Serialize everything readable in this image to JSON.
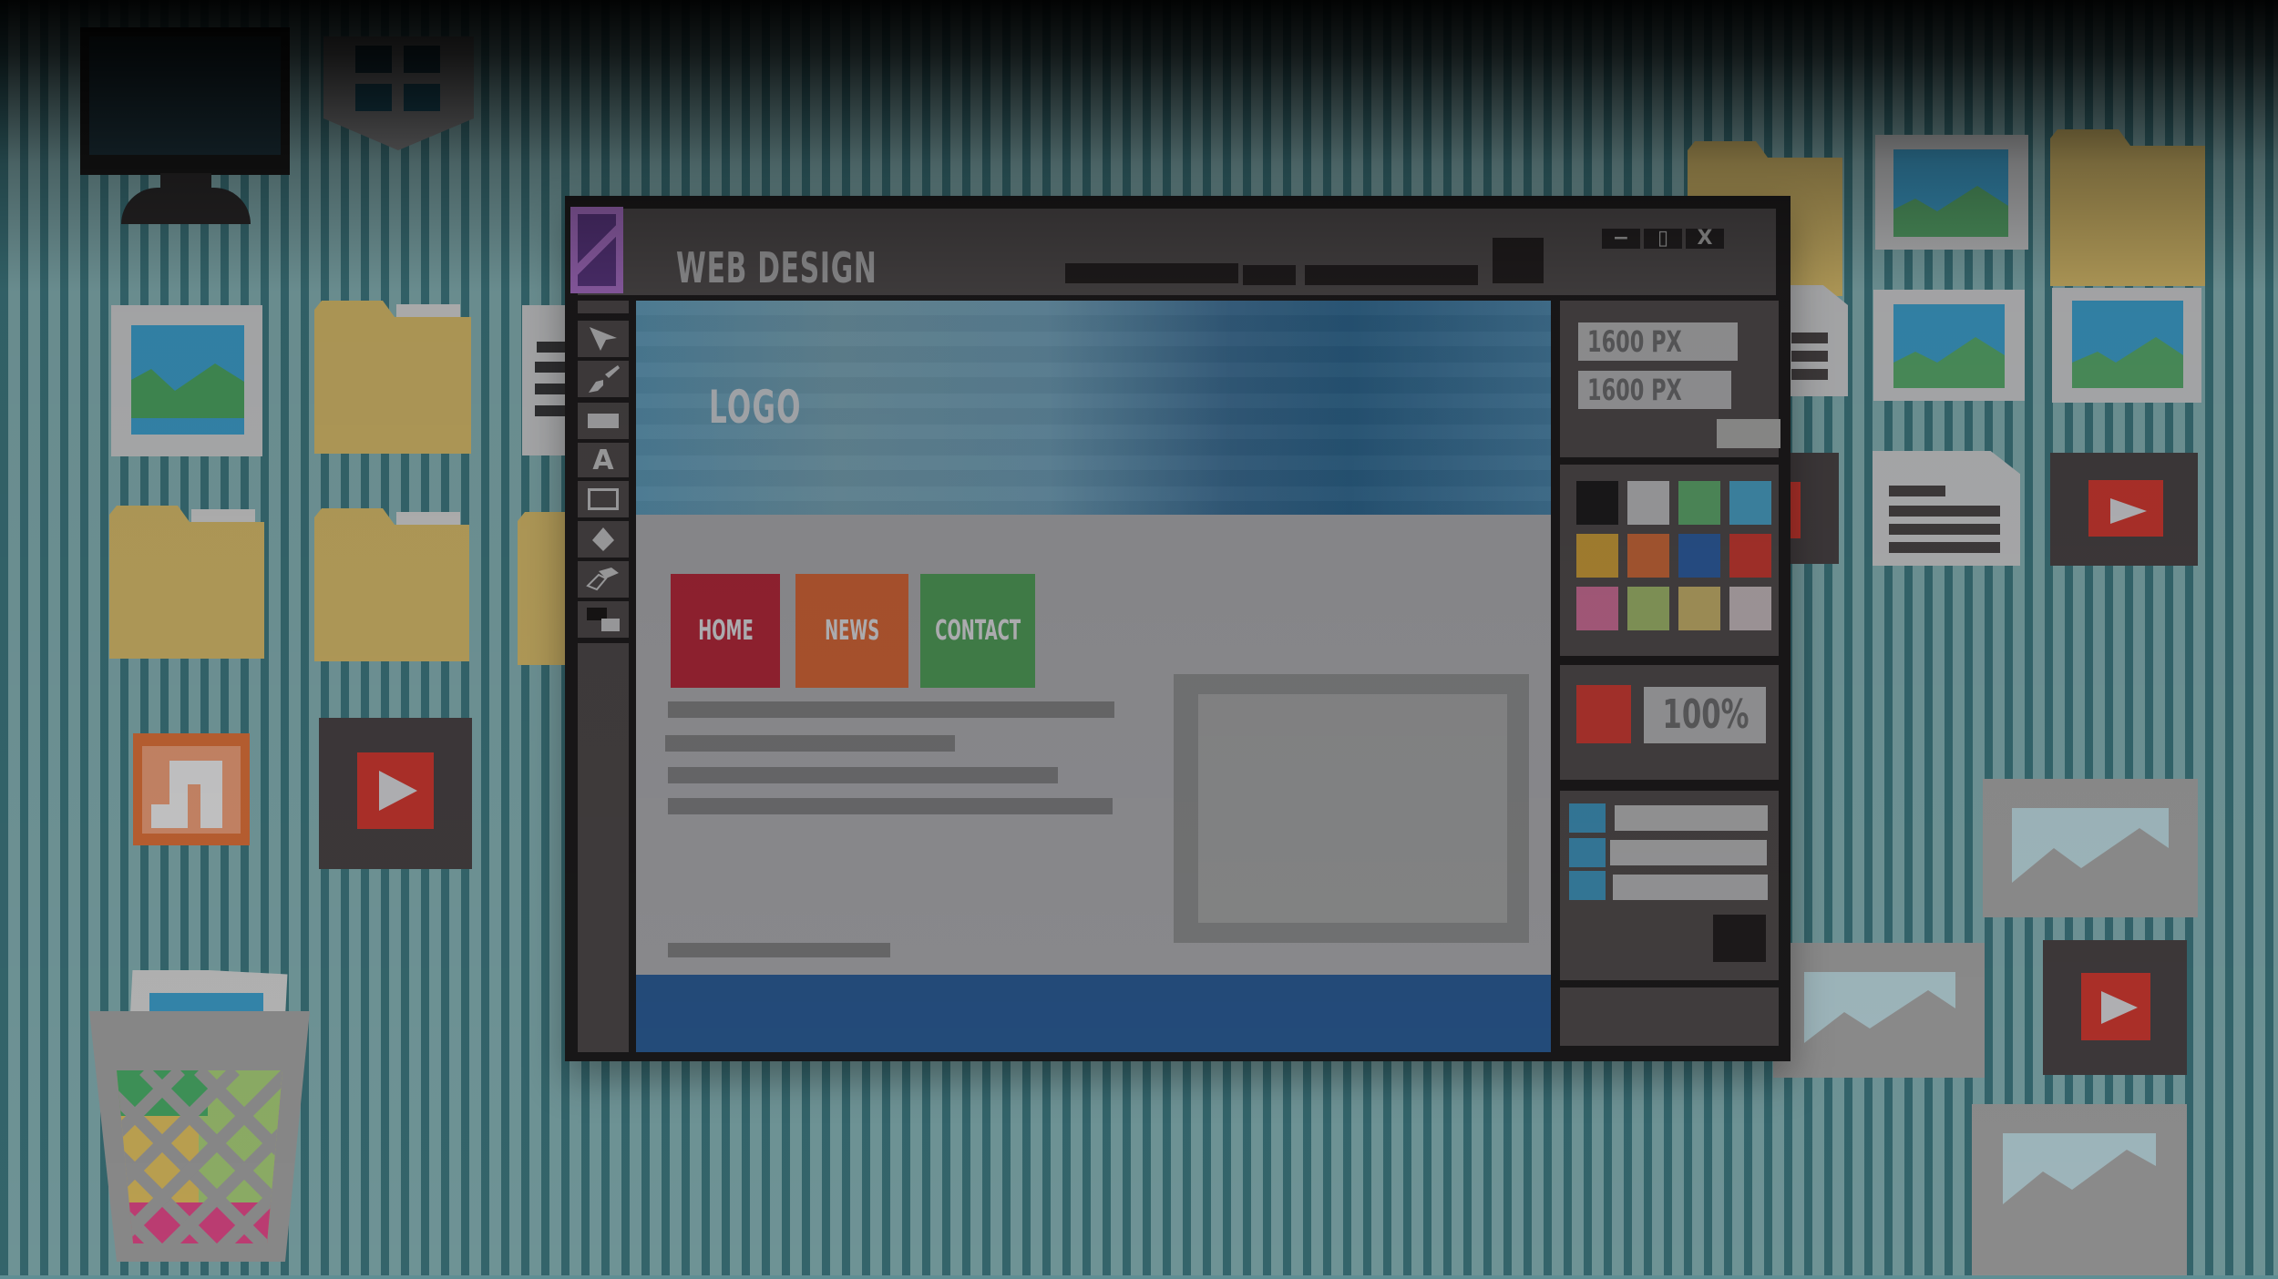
{
  "window": {
    "title": "WEB DESIGN",
    "controls": {
      "minimize": "−",
      "maximize": "▯",
      "close": "X"
    }
  },
  "toolbar": {
    "tools": [
      {
        "name": "select-tool",
        "icon": "arrow-pointer-icon"
      },
      {
        "name": "brush-tool",
        "icon": "paintbrush-icon"
      },
      {
        "name": "rectangle-fill-tool",
        "icon": "filled-rectangle-icon"
      },
      {
        "name": "text-tool",
        "icon": "letter-a-icon",
        "glyph": "A"
      },
      {
        "name": "rectangle-outline-tool",
        "icon": "outline-rectangle-icon"
      },
      {
        "name": "shape-tool",
        "icon": "diamond-icon"
      },
      {
        "name": "eraser-tool",
        "icon": "eraser-icon"
      },
      {
        "name": "color-swap-tool",
        "icon": "fg-bg-color-icon"
      }
    ]
  },
  "canvas": {
    "logo": "LOGO",
    "nav": [
      {
        "label": "HOME",
        "color": "#b0283a"
      },
      {
        "label": "NEWS",
        "color": "#cf6437"
      },
      {
        "label": "CONTACT",
        "color": "#4f9a58"
      }
    ],
    "colors": {
      "hero_start": "#5d99b8",
      "hero_end": "#2f6790",
      "footer": "#2b5c95",
      "body": "#a8a8ac"
    }
  },
  "properties": {
    "width": "1600 PX",
    "height": "1600 PX",
    "zoom": "100%",
    "current_color": "#c93b33",
    "palette": [
      "#1f1d1e",
      "#b9b9bc",
      "#5ea66c",
      "#4aa0c4",
      "#c79a3a",
      "#c8683a",
      "#2f5ea0",
      "#c63a33",
      "#c86c94",
      "#9cb36a",
      "#c2ae6a",
      "#c2b7ba"
    ],
    "layers_count": 3
  },
  "desktop": {
    "icons": [
      "monitor-icon",
      "shield-icon",
      "image-file-icon",
      "folder-icon",
      "document-icon",
      "music-file-icon",
      "video-file-icon",
      "trash-icon"
    ]
  }
}
